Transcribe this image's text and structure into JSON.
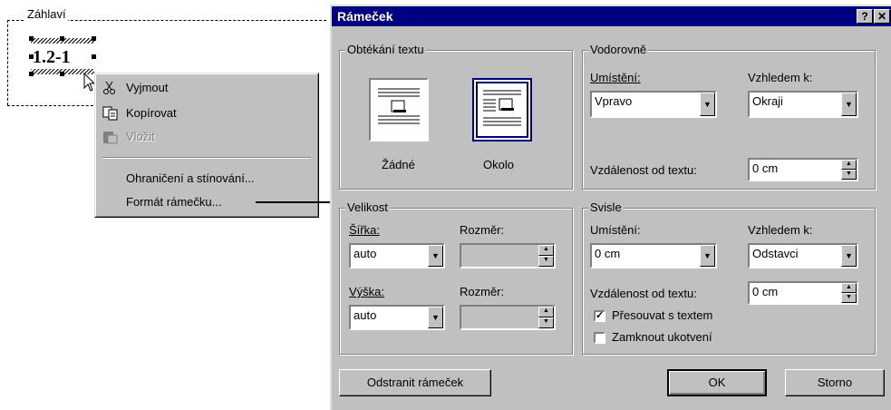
{
  "header_zone": {
    "label": "Záhlaví",
    "frame_text": "1.2-1"
  },
  "context_menu": {
    "items": [
      {
        "icon": "scissors-icon",
        "label": "Vyjmout",
        "enabled": true
      },
      {
        "icon": "copy-icon",
        "label": "Kopírovat",
        "enabled": true
      },
      {
        "icon": "paste-icon",
        "label": "Vložit",
        "enabled": false
      },
      {
        "label": "Ohraničení a stínování...",
        "enabled": true
      },
      {
        "label": "Formát rámečku...",
        "enabled": true
      }
    ]
  },
  "dialog": {
    "title": "Rámeček",
    "help_button": "?",
    "close_button": "✕",
    "text_wrap": {
      "legend": "Obtékání textu",
      "none_label": "Žádné",
      "around_label": "Okolo",
      "selected": "around"
    },
    "horizontal": {
      "legend": "Vodorovně",
      "position_label": "Umístění:",
      "position_value": "Vpravo",
      "relative_label": "Vzhledem k:",
      "relative_value": "Okraji",
      "distance_label": "Vzdálenost od textu:",
      "distance_value": "0 cm"
    },
    "size": {
      "legend": "Velikost",
      "width_label": "Šířka:",
      "width_value": "auto",
      "width_dim_label": "Rozměr:",
      "width_dim_value": "",
      "height_label": "Výška:",
      "height_value": "auto",
      "height_dim_label": "Rozměr:",
      "height_dim_value": ""
    },
    "vertical": {
      "legend": "Svisle",
      "position_label": "Umístění:",
      "position_value": "0 cm",
      "relative_label": "Vzhledem k:",
      "relative_value": "Odstavci",
      "distance_label": "Vzdálenost od textu:",
      "distance_value": "0 cm",
      "move_with_text_label": "Přesouvat s textem",
      "move_with_text_checked": true,
      "lock_anchor_label": "Zamknout ukotvení",
      "lock_anchor_checked": false
    },
    "buttons": {
      "remove": "Odstranit rámeček",
      "ok": "OK",
      "cancel": "Storno"
    }
  }
}
